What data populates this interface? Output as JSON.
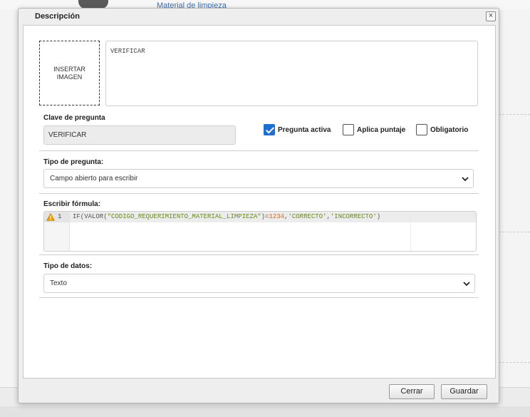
{
  "background": {
    "link_text": "Material de limpieza"
  },
  "dialog": {
    "title": "Descripción",
    "close_glyph": "×",
    "image_placeholder": "INSERTAR IMAGEN",
    "description_text": "VERIFICAR",
    "clave": {
      "label": "Clave de pregunta",
      "value": "VERIFICAR"
    },
    "checkboxes": [
      {
        "label": "Pregunta activa",
        "checked": true
      },
      {
        "label": "Aplica puntaje",
        "checked": false
      },
      {
        "label": "Obligatorio",
        "checked": false
      }
    ],
    "tipo_pregunta": {
      "label": "Tipo de pregunta:",
      "selected": "Campo abierto para escribir"
    },
    "formula": {
      "label": "Escribir fórmula:",
      "line_number": "1",
      "code_parts": {
        "p1": "IF(VALOR(",
        "s1": "\"CODIGO_REQUERIMIENTO_MATERIAL_LIMPIEZA\"",
        "p2": ")=",
        "n1": "1234",
        "p3": ",",
        "s2": "'CORRECTO'",
        "p4": ",",
        "s3": "'INCORRECTO'",
        "p5": ")"
      }
    },
    "tipo_datos": {
      "label": "Tipo de datos:",
      "selected": "Texto"
    },
    "buttons": {
      "cancel": "Cerrar",
      "save": "Guardar"
    }
  },
  "colors": {
    "accent": "#1f6fd1",
    "string": "#6a8a1a",
    "number": "#e0651c",
    "warning": "#e8a000"
  },
  "icons": [
    "close-icon",
    "checkmark-icon",
    "chevron-down-icon",
    "warning-icon"
  ]
}
